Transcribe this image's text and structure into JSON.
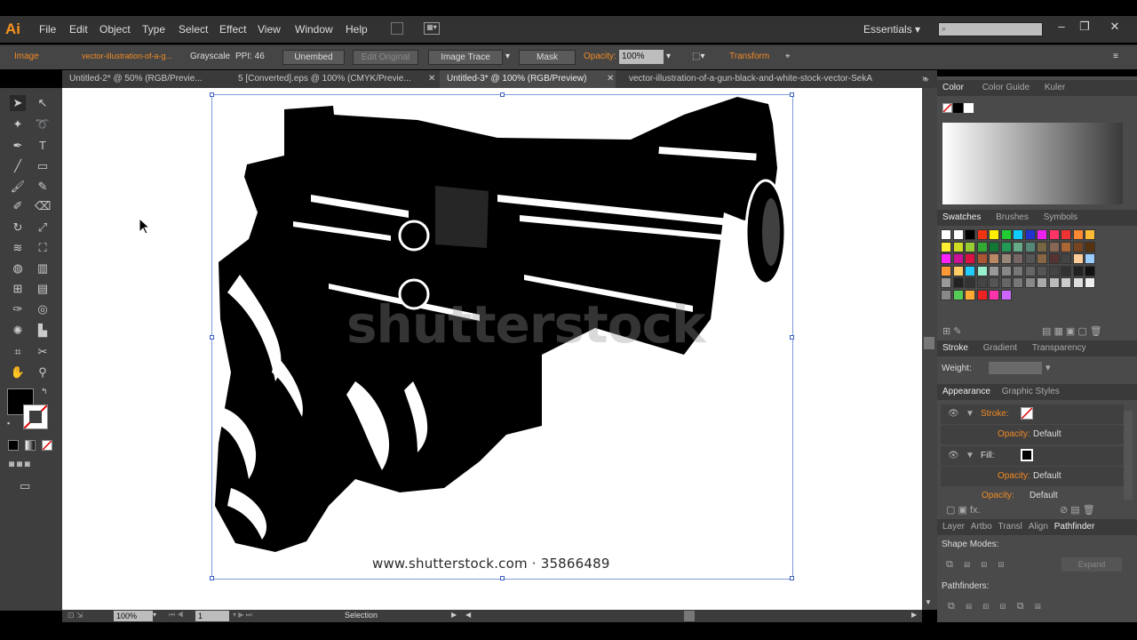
{
  "app": {
    "logo": "Ai"
  },
  "menubar": {
    "items": [
      "File",
      "Edit",
      "Object",
      "Type",
      "Select",
      "Effect",
      "View",
      "Window",
      "Help"
    ],
    "workspace": "Essentials"
  },
  "control_bar": {
    "selection_type": "Image",
    "file_link": "vector-illustration-of-a-g...",
    "color_mode": "Grayscale",
    "ppi": "PPI: 46",
    "unembed": "Unembed",
    "edit_original": "Edit Original",
    "image_trace": "Image Trace",
    "mask": "Mask",
    "opacity_label": "Opacity:",
    "opacity_value": "100%",
    "transform": "Transform"
  },
  "tabs": [
    {
      "label": "Untitled-2* @ 50% (RGB/Previe..."
    },
    {
      "label": "5 [Converted].eps @ 100% (CMYK/Previe..."
    },
    {
      "label": "Untitled-3* @ 100% (RGB/Preview)"
    },
    {
      "label": "vector-illustration-of-a-gun-black-and-white-stock-vector-SekA"
    }
  ],
  "canvas": {
    "watermark": "shutterstock",
    "footer": "www.shutterstock.com · 35866489"
  },
  "status": {
    "zoom": "100%",
    "page": "1",
    "mode": "Selection"
  },
  "panels": {
    "color_tabs": [
      "Color",
      "Color Guide",
      "Kuler"
    ],
    "swatch_tabs": [
      "Swatches",
      "Brushes",
      "Symbols"
    ],
    "stroke_tabs": [
      "Stroke",
      "Gradient",
      "Transparency"
    ],
    "weight_label": "Weight:",
    "appearance_tabs": [
      "Appearance",
      "Graphic Styles"
    ],
    "appearance": {
      "stroke": "Stroke:",
      "opacity": "Opacity:",
      "default": "Default",
      "fill": "Fill:"
    },
    "bottom_tabs": [
      "Layer",
      "Artbo",
      "Transl",
      "Align",
      "Pathfinder"
    ],
    "shape_modes": "Shape Modes:",
    "expand": "Expand",
    "pathfinders": "Pathfinders:"
  },
  "colors": {
    "accent": "#f08a24",
    "selection": "#3b5fc4"
  },
  "icons": [
    "selection-tool-icon",
    "direct-selection-tool-icon",
    "magic-wand-icon",
    "lasso-icon",
    "pen-icon",
    "type-icon",
    "line-icon",
    "rectangle-icon",
    "paintbrush-icon",
    "pencil-icon",
    "blob-brush-icon",
    "eraser-icon",
    "rotate-icon",
    "scale-icon",
    "warp-icon",
    "free-transform-icon",
    "shape-builder-icon",
    "perspective-icon",
    "mesh-icon",
    "gradient-icon",
    "eyedropper-icon",
    "blend-icon",
    "symbol-sprayer-icon",
    "graph-icon",
    "artboard-icon",
    "slice-icon",
    "hand-icon",
    "zoom-icon"
  ]
}
